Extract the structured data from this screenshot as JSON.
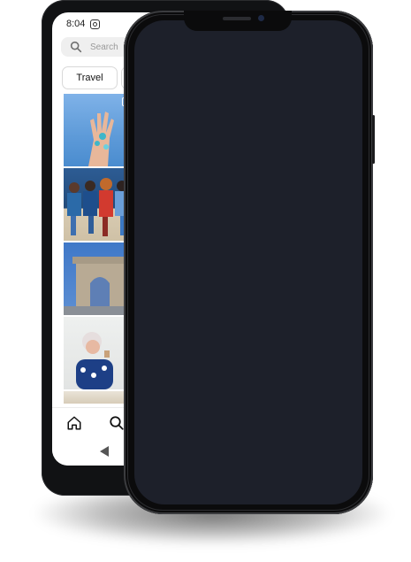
{
  "android_phone": {
    "status_time": "8:04",
    "search": {
      "placeholder": "Search"
    },
    "chips": [
      "Travel"
    ]
  },
  "iphone": {
    "screen_color": "#1d202a"
  },
  "icons": {
    "instagram": "instagram-icon",
    "search": "search-icon",
    "home": "home-icon",
    "back": "back-triangle-icon"
  }
}
